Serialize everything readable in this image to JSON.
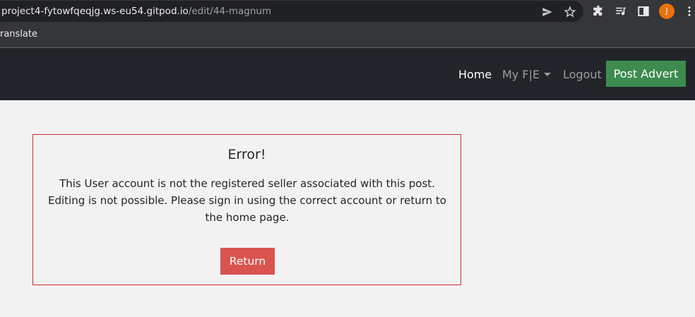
{
  "browser": {
    "url_host": "project4-fytowfqeqjg.ws-eu54.gitpod.io",
    "url_path": "/edit/44-magnum",
    "bookmark_label": "ranslate",
    "avatar_initial": "J",
    "icons": [
      "send-icon",
      "star-icon",
      "extensions-icon",
      "media-control-icon",
      "side-panel-icon",
      "more-vert-icon"
    ]
  },
  "navbar": {
    "home": "Home",
    "my_fe": "My F|E",
    "logout": "Logout",
    "post_advert": "Post Advert",
    "background": "#212529",
    "post_color": "#3d8b4f"
  },
  "error": {
    "title": "Error!",
    "message": "This User account is not the registered seller associated with this post. Editing is not possible. Please sign in using the correct account or return to the home page.",
    "return_label": "Return",
    "accent": "#d9534f"
  }
}
